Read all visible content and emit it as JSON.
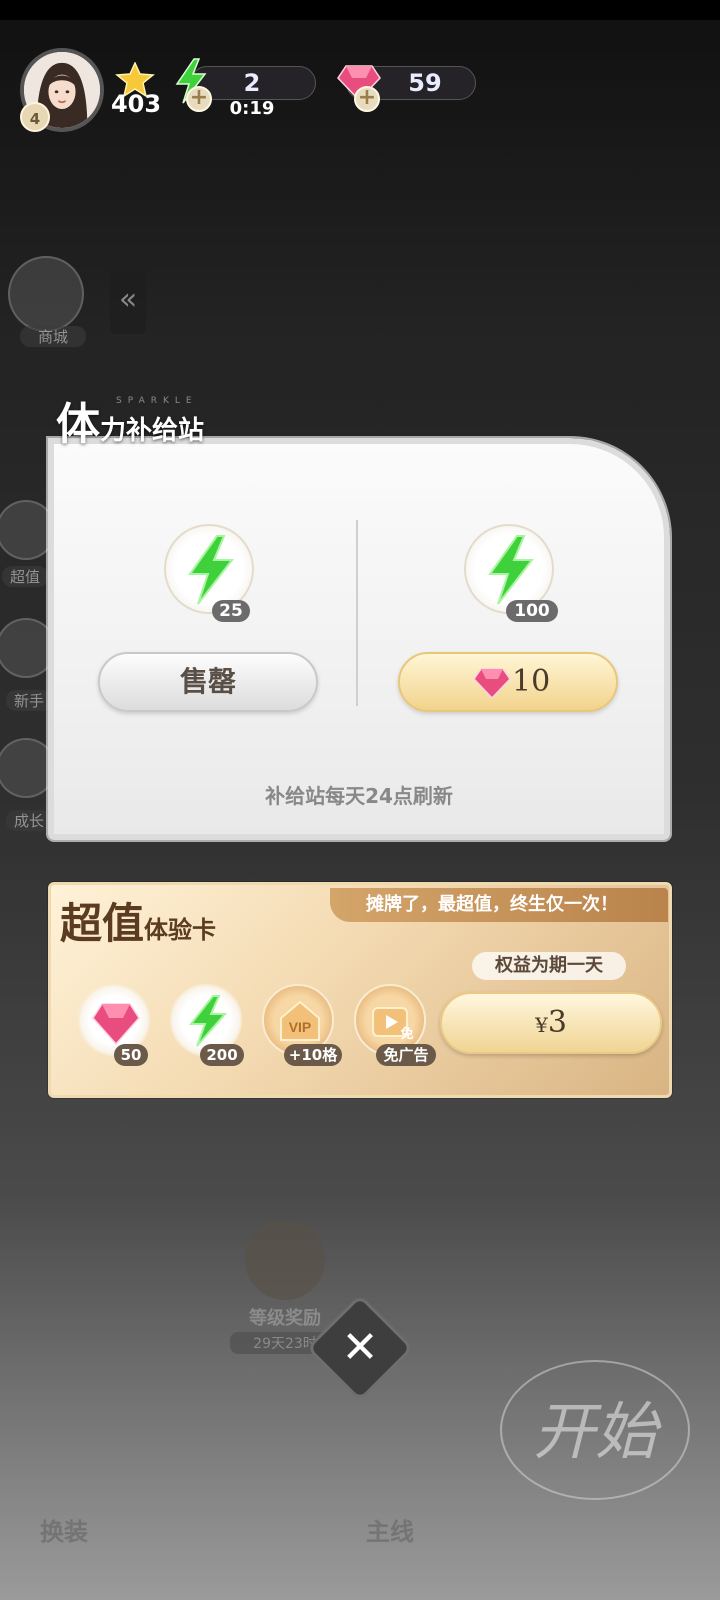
{
  "hud": {
    "level": "4",
    "stars": "403",
    "energy": "2",
    "energy_timer": "0:19",
    "gems": "59"
  },
  "background": {
    "shop_label": "商城",
    "value_label": "超值",
    "newbie_label": "新手",
    "growth_label": "成长",
    "level_reward_label": "等级奖励",
    "level_reward_time": "29天23时",
    "start_label": "开始",
    "dress_label": "换装",
    "main_label": "主线",
    "collapse_glyph": "«"
  },
  "supply": {
    "title_big": "体",
    "title_rest": "力补给站",
    "title_deco": "SPARKLE",
    "left_qty": "25",
    "left_button": "售罄",
    "right_qty": "100",
    "right_price": "10",
    "refresh_note": "补给站每天24点刷新"
  },
  "card": {
    "title_big": "超值",
    "title_rest": "体验卡",
    "slogan": "摊牌了，最超值，终生仅一次！",
    "duration": "权益为期一天",
    "rewards": [
      "50",
      "200",
      "+10格",
      "免广告"
    ],
    "vip_text": "VIP",
    "adfree_badge": "免",
    "currency": "¥",
    "price": "3"
  },
  "close_glyph": "✕",
  "colors": {
    "energy_green": "#3fd13b",
    "gem_pink": "#e94c7f",
    "gold": "#f2d38c"
  }
}
